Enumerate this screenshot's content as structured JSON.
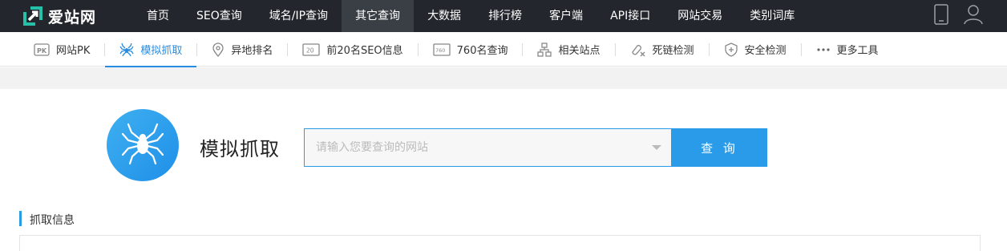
{
  "brand": {
    "name": "爱站网",
    "accent": "#2a9be8"
  },
  "topnav": {
    "items": [
      {
        "label": "首页",
        "active": false
      },
      {
        "label": "SEO查询",
        "active": false
      },
      {
        "label": "域名/IP查询",
        "active": false
      },
      {
        "label": "其它查询",
        "active": true
      },
      {
        "label": "大数据",
        "active": false
      },
      {
        "label": "排行榜",
        "active": false
      },
      {
        "label": "客户端",
        "active": false
      },
      {
        "label": "API接口",
        "active": false
      },
      {
        "label": "网站交易",
        "active": false
      },
      {
        "label": "类别词库",
        "active": false
      }
    ],
    "right_icons": [
      "tablet-icon",
      "user-icon"
    ]
  },
  "subnav": {
    "items": [
      {
        "label": "网站PK",
        "icon": "pk-icon",
        "active": false
      },
      {
        "label": "模拟抓取",
        "icon": "spider-icon",
        "active": true
      },
      {
        "label": "异地排名",
        "icon": "location-pin-icon",
        "active": false
      },
      {
        "label": "前20名SEO信息",
        "icon": "top20-icon",
        "active": false
      },
      {
        "label": "760名查询",
        "icon": "rank760-icon",
        "active": false
      },
      {
        "label": "相关站点",
        "icon": "sitemap-icon",
        "active": false
      },
      {
        "label": "死链检测",
        "icon": "broken-link-icon",
        "active": false
      },
      {
        "label": "安全检测",
        "icon": "shield-icon",
        "active": false
      },
      {
        "label": "更多工具",
        "icon": "more-icon",
        "active": false
      }
    ]
  },
  "main": {
    "title": "模拟抓取",
    "search_placeholder": "请输入您要查询的网站",
    "search_value": "",
    "search_button": "查 询"
  },
  "section": {
    "title": "抓取信息"
  }
}
